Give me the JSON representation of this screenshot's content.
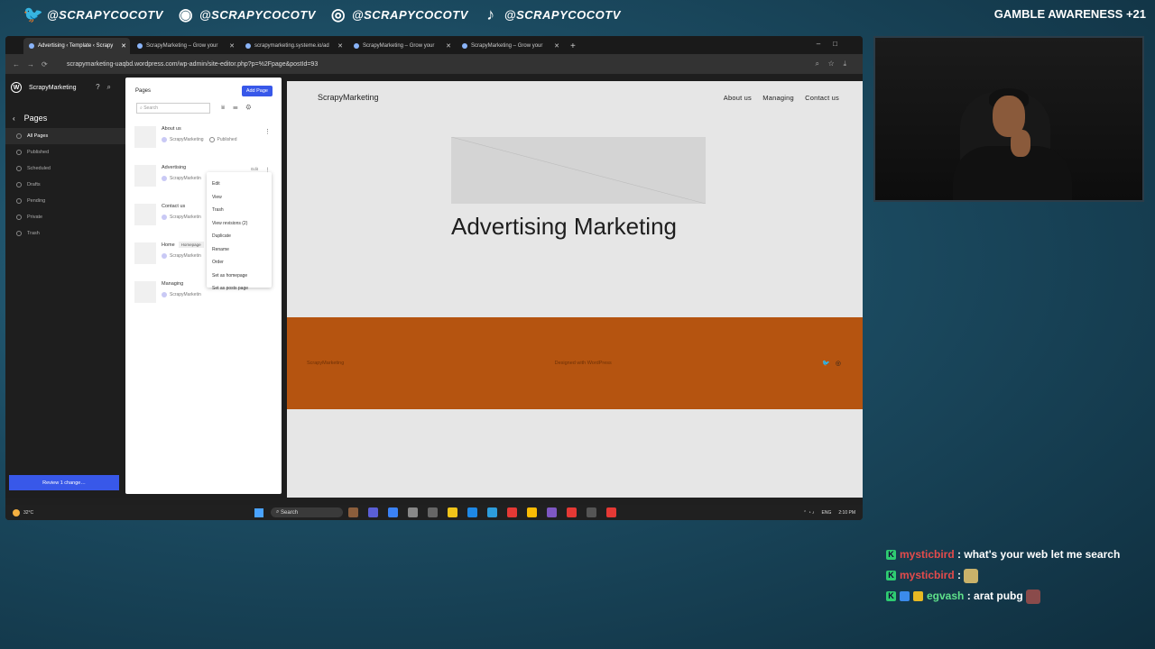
{
  "socials": [
    {
      "icon": "twitter-icon",
      "glyph": "🐦",
      "handle": "@SCRAPYCOCOTV"
    },
    {
      "icon": "discord-icon",
      "glyph": "◉",
      "handle": "@SCRAPYCOCOTV"
    },
    {
      "icon": "instagram-icon",
      "glyph": "◎",
      "handle": "@SCRAPYCOCOTV"
    },
    {
      "icon": "tiktok-icon",
      "glyph": "♪",
      "handle": "@SCRAPYCOCOTV"
    }
  ],
  "gamble_notice": "GAMBLE AWARENESS +21",
  "browser": {
    "tabs": [
      {
        "title": "Advertising ‹ Template ‹ Scrapy",
        "active": true
      },
      {
        "title": "ScrapyMarketing – Grow your",
        "active": false
      },
      {
        "title": "scrapymarketing.systeme.io/ad",
        "active": false
      },
      {
        "title": "ScrapyMarketing – Grow your",
        "active": false
      },
      {
        "title": "ScrapyMarketing – Grow your",
        "active": false
      }
    ],
    "url": "scrapymarketing-uaqbd.wordpress.com/wp-admin/site-editor.php?p=%2Fpage&postId=93"
  },
  "wp": {
    "site_name": "ScrapyMarketing",
    "section_title": "Pages",
    "nav": [
      "All Pages",
      "Published",
      "Scheduled",
      "Drafts",
      "Pending",
      "Private",
      "Trash"
    ],
    "review_button": "Review 1 change…",
    "list_title": "Pages",
    "add_page": "Add Page",
    "search_placeholder": "Search",
    "pages": [
      {
        "title": "About us",
        "author": "ScrapyMarketing",
        "status": "Published"
      },
      {
        "title": "Advertising",
        "author": "ScrapyMarketin",
        "edit": "Edit"
      },
      {
        "title": "Contact us",
        "author": "ScrapyMarketin"
      },
      {
        "title": "Home",
        "badge": "Homepage",
        "author": "ScrapyMarketin"
      },
      {
        "title": "Managing",
        "author": "ScrapyMarketin"
      }
    ],
    "context_menu": [
      "Edit",
      "View",
      "Trash",
      "View revisions (2)",
      "Duplicate",
      "Rename",
      "Order",
      "Set as homepage",
      "Set as posts page"
    ]
  },
  "site": {
    "title": "ScrapyMarketing",
    "nav": [
      "About us",
      "Managing",
      "Contact us"
    ],
    "hero_title": "Advertising Marketing",
    "footer_left": "ScrapyMarketing",
    "footer_center": "Designed with WordPress"
  },
  "taskbar": {
    "weather": "32°C",
    "search": "Search",
    "lang": "ENG",
    "time": "2:10 PM",
    "app_colors": [
      "#8b5e3c",
      "#5a5fd6",
      "#3b82f6",
      "#888888",
      "#666666",
      "#f0c419",
      "#1e88e5",
      "#2d9cdb",
      "#e53935",
      "#fbbc04",
      "#7e57c2",
      "#e53935",
      "#555555",
      "#e53935"
    ]
  },
  "chat": [
    {
      "user": "mysticbird",
      "color": "red",
      "text": ": what's your web let me search",
      "badges": [
        "K"
      ]
    },
    {
      "user": "mysticbird",
      "color": "red",
      "text": ":",
      "badges": [
        "K"
      ],
      "emote": true
    },
    {
      "user": "egvash",
      "color": "green",
      "text": ": arat pubg",
      "badges": [
        "K",
        "b2",
        "b3"
      ],
      "emote": true
    }
  ]
}
